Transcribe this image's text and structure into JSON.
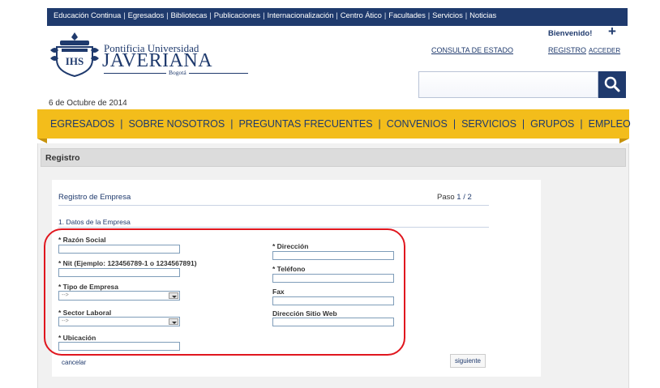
{
  "top_links": [
    "Educación Continua",
    "Egresados",
    "Bibliotecas",
    "Publicaciones",
    "Internacionalización",
    "Centro Ático",
    "Facultades",
    "Servicios",
    "Noticias"
  ],
  "logo": {
    "line1": "Pontificia Universidad",
    "line2": "JAVERIANA",
    "city": "Bogotá"
  },
  "header": {
    "welcome": "Bienvenido!",
    "plus": "+",
    "consulta": "CONSULTA DE ESTADO",
    "registro": "REGISTRO",
    "acceder": "ACCEDER",
    "search_value": ""
  },
  "date": "6 de Octubre de 2014",
  "nav": [
    "EGRESADOS",
    "SOBRE NOSOTROS",
    "PREGUNTAS FRECUENTES",
    "CONVENIOS",
    "SERVICIOS",
    "GRUPOS",
    "EMPLEO"
  ],
  "nav_separator": "|",
  "section_title": "Registro",
  "form": {
    "title": "Registro de Empresa",
    "step_label": "Paso",
    "step_value": "1 / 2",
    "subhead": "1. Datos de la Empresa",
    "left": {
      "razon_social": "* Razón Social",
      "nit": "* Nit (Ejemplo: 123456789-1 o 1234567891)",
      "tipo": "* Tipo de Empresa",
      "tipo_value": "-->",
      "sector": "* Sector Laboral",
      "sector_value": "-->",
      "ubicacion": "* Ubicación"
    },
    "right": {
      "direccion": "* Dirección",
      "telefono": "* Teléfono",
      "fax": "Fax",
      "web": "Dirección Sitio Web"
    },
    "cancel": "cancelar",
    "next": "siguiente"
  },
  "colors": {
    "brand_navy": "#1f3a6d",
    "nav_yellow": "#f3bd1b",
    "highlight_red": "#e0161e"
  }
}
